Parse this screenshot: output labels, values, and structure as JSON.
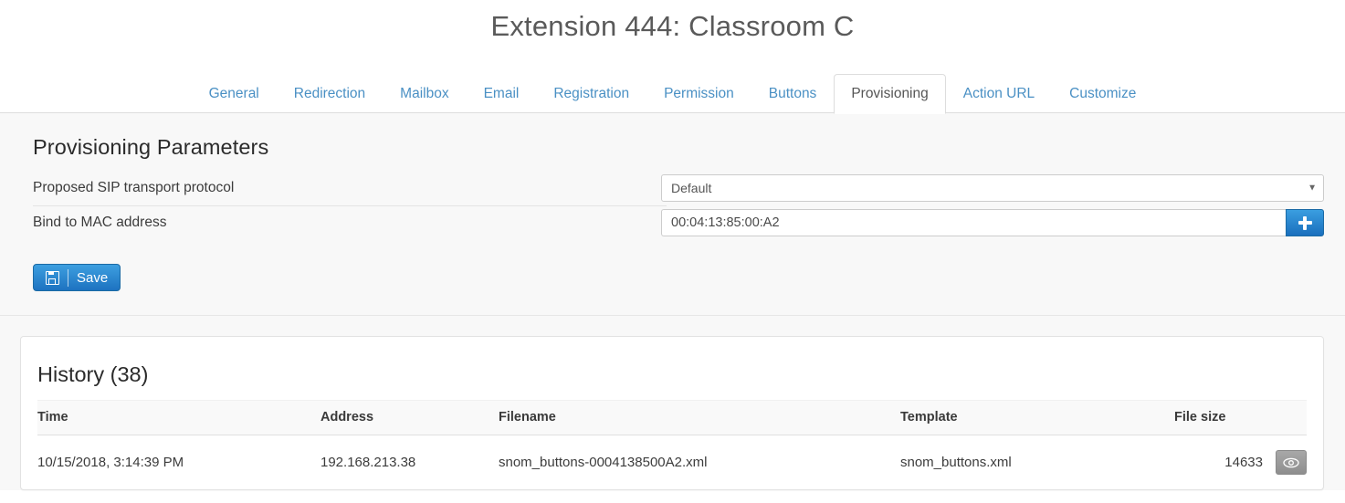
{
  "header": {
    "title": "Extension 444: Classroom C"
  },
  "tabs": [
    {
      "label": "General",
      "active": false
    },
    {
      "label": "Redirection",
      "active": false
    },
    {
      "label": "Mailbox",
      "active": false
    },
    {
      "label": "Email",
      "active": false
    },
    {
      "label": "Registration",
      "active": false
    },
    {
      "label": "Permission",
      "active": false
    },
    {
      "label": "Buttons",
      "active": false
    },
    {
      "label": "Provisioning",
      "active": true
    },
    {
      "label": "Action URL",
      "active": false
    },
    {
      "label": "Customize",
      "active": false
    }
  ],
  "provisioning": {
    "section_title": "Provisioning Parameters",
    "transport": {
      "label": "Proposed SIP transport protocol",
      "value": "Default",
      "options": [
        "Default"
      ]
    },
    "mac": {
      "label": "Bind to MAC address",
      "value": "00:04:13:85:00:A2",
      "placeholder": "",
      "add_button_icon": "plus-icon"
    },
    "save_label": "Save",
    "save_icon": "save-floppy-icon"
  },
  "history": {
    "title": "History (38)",
    "count": 38,
    "columns": [
      "Time",
      "Address",
      "Filename",
      "Template",
      "File size"
    ],
    "rows": [
      {
        "time": "10/15/2018, 3:14:39 PM",
        "address": "192.168.213.38",
        "filename": "snom_buttons-0004138500A2.xml",
        "template": "snom_buttons.xml",
        "filesize": "14633",
        "view_icon": "eye-icon"
      }
    ]
  },
  "colors": {
    "link": "#4a90c4",
    "primary": "#1d72c0",
    "content_bg": "#f8f8f8",
    "card_bg": "#ffffff",
    "text": "#333333"
  }
}
